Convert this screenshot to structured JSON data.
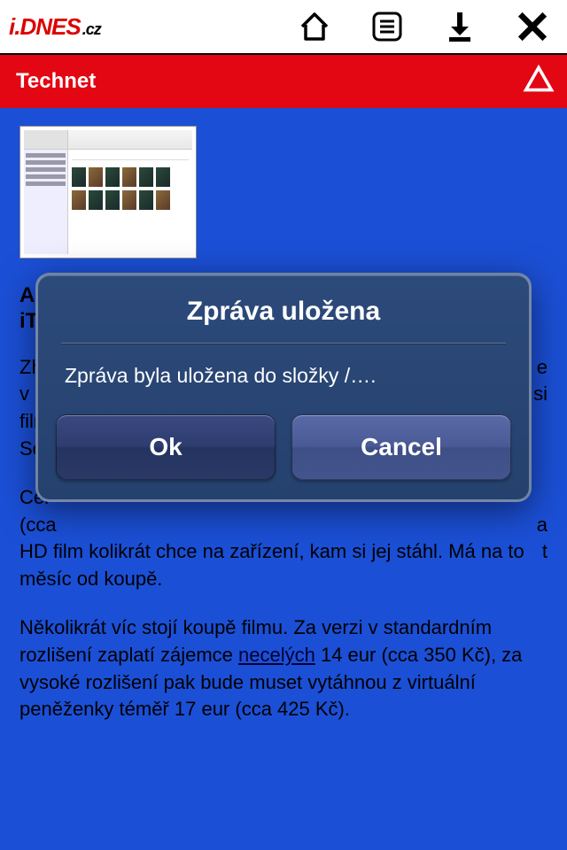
{
  "logo": {
    "i": "i",
    "dnes": ".DNES",
    "cz": ".cz"
  },
  "section": "Technet",
  "article": {
    "title_partial": "App\niTu",
    "para1_prefix": "Zhr\nv Č\nfilm\nSer",
    "para2_prefix": "Cer\n(cca\nHD",
    "para2_suffix": " film kolikrát chce na zařízení, kam si jej stáhl. Má na to měsíc od koupě.",
    "para3_pre": "Několikrát víc stojí koupě filmu. Za verzi v standardním rozlišení zaplatí zájemce ",
    "para3_link": "necelých",
    "para3_post": " 14 eur (cca 350 Kč), za vysoké rozlišení pak bude muset vytáhnou z virtuální peněženky téměř 17 eur (cca 425 Kč).",
    "para1_suffix_e": "e",
    "para1_suffix_si": "si",
    "para2_suffix_a": "a",
    "para2_suffix_t": "t"
  },
  "modal": {
    "title": "Zpráva uložena",
    "message": "Zpráva byla uložena do složky /….",
    "ok": "Ok",
    "cancel": "Cancel"
  }
}
